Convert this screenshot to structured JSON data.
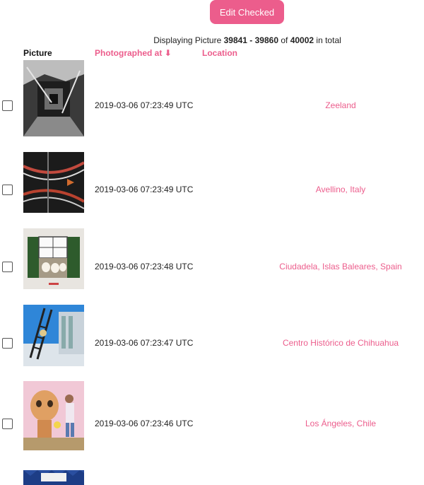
{
  "toolbar": {
    "edit_checked_label": "Edit Checked"
  },
  "summary": {
    "prefix": "Displaying Picture",
    "range": "39841 - 39860",
    "of": "of",
    "total": "40002",
    "suffix": "in total"
  },
  "table": {
    "headers": {
      "picture": "Picture",
      "photographed_at": "Photographed at",
      "sort_indicator": "down-arrow-icon",
      "location": "Location"
    },
    "rows": [
      {
        "timestamp": "2019-03-06 07:23:49 UTC",
        "location": "Zeeland"
      },
      {
        "timestamp": "2019-03-06 07:23:49 UTC",
        "location": "Avellino, Italy"
      },
      {
        "timestamp": "2019-03-06 07:23:48 UTC",
        "location": "Ciudadela, Islas Baleares, Spain"
      },
      {
        "timestamp": "2019-03-06 07:23:47 UTC",
        "location": "Centro Histórico de Chihuahua"
      },
      {
        "timestamp": "2019-03-06 07:23:46 UTC",
        "location": "Los Ángeles, Chile"
      }
    ]
  },
  "colors": {
    "accent": "#ec5d8c"
  }
}
